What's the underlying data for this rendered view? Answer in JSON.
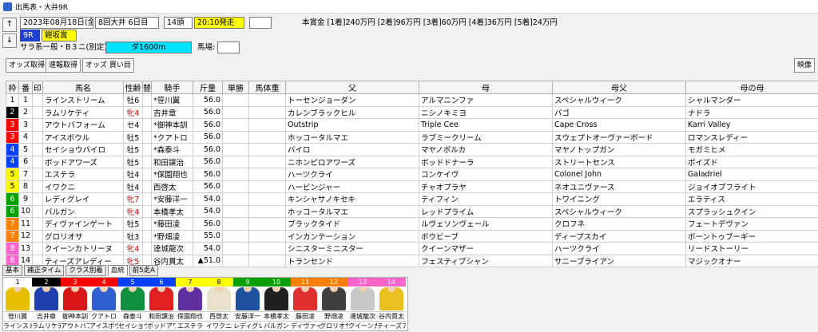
{
  "window": {
    "title": "出馬表・大井9R"
  },
  "header": {
    "date": "2023年08月18日(金)",
    "meeting": "8回大井 6日目",
    "heads": "14頭",
    "start_time": "20:10発走",
    "prize": "本賞金 [1着]240万円 [2着]96万円 [3着]60万円 [4着]36万円 [5着]24万円",
    "race_no": "9R",
    "race_name": "鎧坂賞",
    "condition": "サラ系一般・B３ニ(別定)",
    "course": "ダ1600m",
    "track_label": "馬場:",
    "track_value": ""
  },
  "nav": {
    "up": "↑",
    "down": "↓"
  },
  "toolbar": {
    "odds_fetch": "オッズ取得",
    "results_fetch": "速報取得",
    "odds_buy": "オッズ 買い目",
    "image": "映像"
  },
  "table": {
    "columns": [
      "枠",
      "番",
      "印",
      "馬名",
      "性齢",
      "替",
      "騎手",
      "斤量",
      "単勝",
      "馬体重",
      "父",
      "母",
      "母父",
      "母の母"
    ],
    "rows": [
      {
        "waku": "1",
        "umaban": "1",
        "mark": "",
        "name": "ラインストリーム",
        "sexage": "牡6",
        "change": "",
        "jockey": "*笹川翼",
        "weight": "56.0",
        "odds": "",
        "body": "",
        "sire": "トーセンジョーダン",
        "dam": "アルマニンファ",
        "damsire": "スペシャルウィーク",
        "damdam": "シャルマンダー"
      },
      {
        "waku": "2",
        "umaban": "2",
        "mark": "",
        "name": "ラムリケティ",
        "sexage": "牝4",
        "change": "",
        "jockey": "吉井章",
        "weight": "56.0",
        "odds": "",
        "body": "",
        "sire": "カレンブラックヒル",
        "dam": "ニシノキミヨ",
        "damsire": "バゴ",
        "damdam": "ナドラ"
      },
      {
        "waku": "3",
        "umaban": "3",
        "mark": "",
        "name": "アウトバフォーム",
        "sexage": "セ4",
        "change": "",
        "jockey": "*御神本訓",
        "weight": "56.0",
        "odds": "",
        "body": "",
        "sire": "Outstrip",
        "dam": "Triple Cee",
        "damsire": "Cape Cross",
        "damdam": "Karri Valley"
      },
      {
        "waku": "3",
        "umaban": "4",
        "mark": "",
        "name": "アイスボウル",
        "sexage": "牡5",
        "change": "",
        "jockey": "*クアトロ",
        "weight": "56.0",
        "odds": "",
        "body": "",
        "sire": "ホッコータルマエ",
        "dam": "ラブミークリーム",
        "damsire": "スウェプトオーヴァーボード",
        "damdam": "ロマンスレディー"
      },
      {
        "waku": "4",
        "umaban": "5",
        "mark": "",
        "name": "セイショウバイロ",
        "sexage": "牡5",
        "change": "",
        "jockey": "*森泰斗",
        "weight": "56.0",
        "odds": "",
        "body": "",
        "sire": "バイロ",
        "dam": "マヤノボルカ",
        "damsire": "マヤノトップガン",
        "damdam": "モガミヒメ"
      },
      {
        "waku": "4",
        "umaban": "6",
        "mark": "",
        "name": "ボッドアワーズ",
        "sexage": "牡5",
        "change": "",
        "jockey": "和田譲治",
        "weight": "56.0",
        "odds": "",
        "body": "",
        "sire": "ニホンピロアワーズ",
        "dam": "ボッドドナーラ",
        "damsire": "ストリートセンス",
        "damdam": "ボイズド"
      },
      {
        "waku": "5",
        "umaban": "7",
        "mark": "",
        "name": "エステラ",
        "sexage": "牡4",
        "change": "",
        "jockey": "*保園翔也",
        "weight": "56.0",
        "odds": "",
        "body": "",
        "sire": "ハーツクライ",
        "dam": "コンケイヴ",
        "damsire": "Colonel John",
        "damdam": "Galadriel"
      },
      {
        "waku": "5",
        "umaban": "8",
        "mark": "",
        "name": "イワクニ",
        "sexage": "牡4",
        "change": "",
        "jockey": "西啓太",
        "weight": "56.0",
        "odds": "",
        "body": "",
        "sire": "ハービンジャー",
        "dam": "チャオプラヤ",
        "damsire": "ネオユニヴァース",
        "damdam": "ジョイオブフライト"
      },
      {
        "waku": "6",
        "umaban": "9",
        "mark": "",
        "name": "レディグレイ",
        "sexage": "牝7",
        "change": "",
        "jockey": "*安藤洋一",
        "weight": "54.0",
        "odds": "",
        "body": "",
        "sire": "キンシャサノキセキ",
        "dam": "ティフィン",
        "damsire": "トワイニング",
        "damdam": "エラティス"
      },
      {
        "waku": "6",
        "umaban": "10",
        "mark": "",
        "name": "バルガン",
        "sexage": "牝4",
        "change": "",
        "jockey": "本橋孝太",
        "weight": "54.0",
        "odds": "",
        "body": "",
        "sire": "ホッコータルマエ",
        "dam": "レッドプライム",
        "damsire": "スペシャルウィーク",
        "damdam": "スプラッシュクイン"
      },
      {
        "waku": "7",
        "umaban": "11",
        "mark": "",
        "name": "ディヴァインゲート",
        "sexage": "牡5",
        "change": "",
        "jockey": "*藤田凌",
        "weight": "56.0",
        "odds": "",
        "body": "",
        "sire": "ブラックタイド",
        "dam": "ルヴェソンヴェール",
        "damsire": "クロフネ",
        "damdam": "フェートデヴァン"
      },
      {
        "waku": "7",
        "umaban": "12",
        "mark": "",
        "name": "グロリオサ",
        "sexage": "牡3",
        "change": "",
        "jockey": "*野畑凌",
        "weight": "55.0",
        "odds": "",
        "body": "",
        "sire": "インカンテーション",
        "dam": "ボウビーブ",
        "damsire": "ディープスカイ",
        "damdam": "ボーントゥブーギー"
      },
      {
        "waku": "8",
        "umaban": "13",
        "mark": "",
        "name": "クイーンカトリーヌ",
        "sexage": "牝4",
        "change": "",
        "jockey": "達城龍次",
        "weight": "54.0",
        "odds": "",
        "body": "",
        "sire": "シニスターミニスター",
        "dam": "クイーンマザー",
        "damsire": "ハーツクライ",
        "damdam": "リードストーリー"
      },
      {
        "waku": "8",
        "umaban": "14",
        "mark": "",
        "name": "ティーズアレディー",
        "sexage": "牝5",
        "change": "",
        "jockey": "谷内貫太",
        "weight": "▲51.0",
        "odds": "",
        "body": "",
        "sire": "トランセンド",
        "dam": "フェスティブシャン",
        "damsire": "サニーブライアン",
        "damdam": "マジックオナー"
      }
    ]
  },
  "tabs": [
    "基本",
    "補正タイム",
    "クラス別着",
    "血統",
    "前5走A"
  ],
  "waku_colors": {
    "1": "#ffffff",
    "2": "#000000",
    "3": "#ff0000",
    "4": "#0040ff",
    "5": "#ffff00",
    "6": "#00a000",
    "7": "#ff8000",
    "8": "#ff66cc"
  },
  "silks": [
    {
      "num": "1",
      "jockey": "笹川翼",
      "horse": "ラインスト",
      "color": "#e7c000",
      "numbg": "#ffffff",
      "numfg": "#000000"
    },
    {
      "num": "2",
      "jockey": "吉井章",
      "horse": "ラムリケテ",
      "color": "#2040b0",
      "numbg": "#000000",
      "numfg": "#ffffff"
    },
    {
      "num": "3",
      "jockey": "御神本訓",
      "horse": "アウトバフ",
      "color": "#d81818",
      "numbg": "#ff0000",
      "numfg": "#ffffff"
    },
    {
      "num": "4",
      "jockey": "クアトロ",
      "horse": "アイスボウ",
      "color": "#3060d0",
      "numbg": "#ff0000",
      "numfg": "#ffffff"
    },
    {
      "num": "5",
      "jockey": "森泰斗",
      "horse": "セイショウ",
      "color": "#109040",
      "numbg": "#0040ff",
      "numfg": "#ffffff"
    },
    {
      "num": "6",
      "jockey": "和田譲治",
      "horse": "ボッドアワ",
      "color": "#e02020",
      "numbg": "#0040ff",
      "numfg": "#ffffff"
    },
    {
      "num": "7",
      "jockey": "保園翔也",
      "horse": "エステラ",
      "color": "#6030a0",
      "numbg": "#ffff00",
      "numfg": "#000000"
    },
    {
      "num": "8",
      "jockey": "西啓太",
      "horse": "イワクニ",
      "color": "#e8e0c8",
      "numbg": "#ffff00",
      "numfg": "#000000"
    },
    {
      "num": "9",
      "jockey": "安藤洋一",
      "horse": "レディグレ",
      "color": "#2050a0",
      "numbg": "#00a000",
      "numfg": "#ffffff"
    },
    {
      "num": "10",
      "jockey": "本橋孝太",
      "horse": "バルガン",
      "color": "#202020",
      "numbg": "#00a000",
      "numfg": "#ffffff"
    },
    {
      "num": "11",
      "jockey": "藤田凌",
      "horse": "ディヴァイ",
      "color": "#e03030",
      "numbg": "#ff8000",
      "numfg": "#ffffff"
    },
    {
      "num": "12",
      "jockey": "野畑凌",
      "horse": "グロリオサ",
      "color": "#404040",
      "numbg": "#ff8000",
      "numfg": "#ffffff"
    },
    {
      "num": "13",
      "jockey": "達城龍次",
      "horse": "クイーンカ",
      "color": "#c8c8c8",
      "numbg": "#ff66cc",
      "numfg": "#ffffff"
    },
    {
      "num": "14",
      "jockey": "谷内貫太",
      "horse": "ティーズア",
      "color": "#e8c020",
      "numbg": "#ff66cc",
      "numfg": "#ffffff"
    }
  ]
}
